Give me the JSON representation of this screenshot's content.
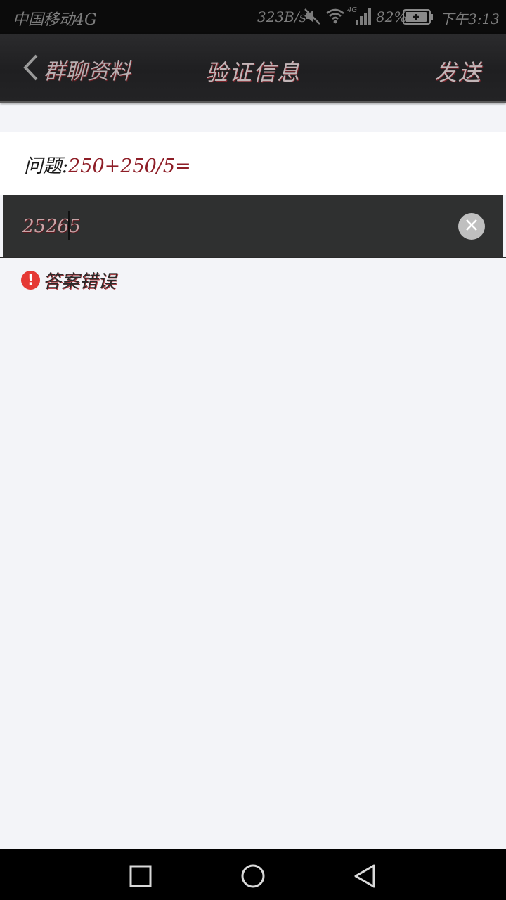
{
  "status_bar": {
    "carrier": "中国移动4G",
    "speed": "323B/s",
    "network_type": "4G",
    "battery_percent": "82%",
    "time": "下午3:13",
    "icons": [
      "mute-icon",
      "wifi-icon",
      "signal-icon",
      "battery-icon"
    ]
  },
  "nav": {
    "back_label": "群聊资料",
    "title": "验证信息",
    "send_label": "发送"
  },
  "question": {
    "prefix": "问题:",
    "expression": "250+250/5="
  },
  "answer": {
    "value": "25265"
  },
  "error": {
    "icon_glyph": "!",
    "message": "答案错误"
  },
  "system_nav": {
    "icons": [
      "recent-apps-icon",
      "home-icon",
      "back-icon"
    ]
  },
  "colors": {
    "nav_background": "#222224",
    "accent_red": "#8e1e27",
    "error_red": "#e53935",
    "page_background": "#f3f4f8"
  }
}
